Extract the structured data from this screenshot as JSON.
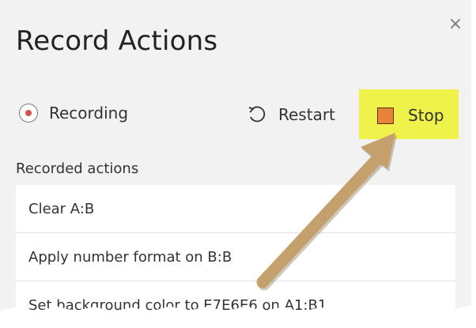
{
  "panel": {
    "title": "Record Actions",
    "close_icon": "close-icon",
    "close_glyph": "×"
  },
  "toolbar": {
    "recording_label": "Recording",
    "recording_icon": "record-icon",
    "restart_label": "Restart",
    "restart_icon": "restart-icon",
    "stop_label": "Stop",
    "stop_icon": "stop-icon",
    "stop_color": "#e8833a",
    "highlight_color": "#eef24a"
  },
  "recorded": {
    "label": "Recorded actions",
    "items": [
      {
        "label": "Clear A:B"
      },
      {
        "label": "Apply number format on B:B"
      },
      {
        "label": "Set background color to E7E6E6 on A1:B1"
      }
    ]
  },
  "annotation": {
    "arrow_color": "#c4a06c",
    "arrow_icon": "annotation-arrow"
  }
}
